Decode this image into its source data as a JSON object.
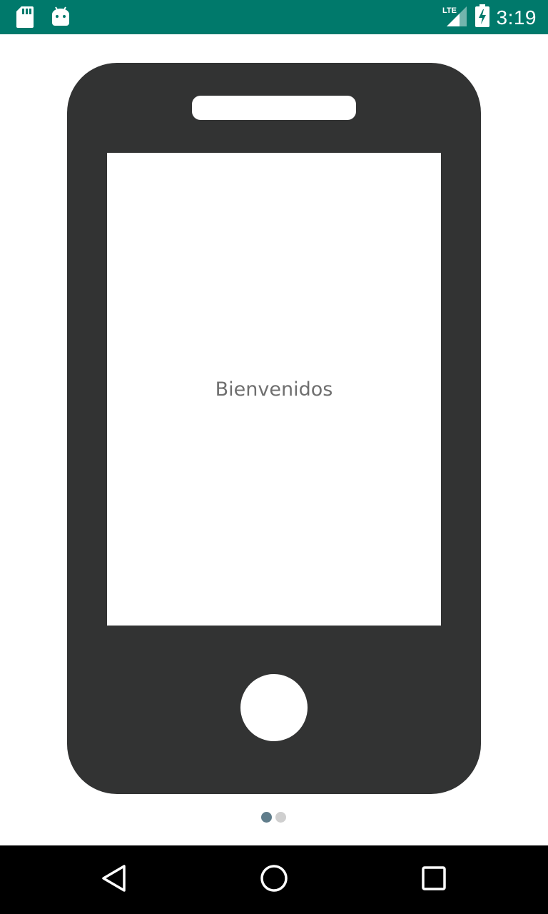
{
  "status_bar": {
    "time": "3:19",
    "network": "LTE",
    "background_color": "#00796b",
    "icons": [
      "sd-card-icon",
      "android-icon",
      "lte-signal-icon",
      "battery-charging-icon"
    ]
  },
  "main": {
    "welcome_text": "Bienvenidos",
    "illustration": "phone-icon",
    "phone_color": "#323333"
  },
  "page_indicator": {
    "total": 2,
    "active_index": 0,
    "active_color": "#607d8b",
    "inactive_color": "#cfcfcf"
  },
  "nav_bar": {
    "buttons": [
      "back-icon",
      "home-icon",
      "recents-icon"
    ]
  }
}
